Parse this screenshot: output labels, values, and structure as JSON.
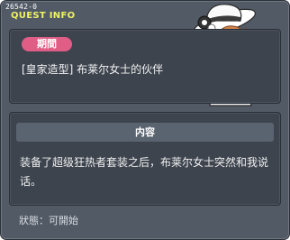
{
  "window": {
    "quest_id": "26542-0",
    "title": "QUEST INFO"
  },
  "period": {
    "badge_label": "期間",
    "badge_color": "#e05d86"
  },
  "quest": {
    "name": "[皇家造型] 布莱尔女士的伙伴"
  },
  "content": {
    "header": "内容",
    "text": "装备了超级狂热者套装之后，布莱尔女士突然和我说话。"
  },
  "status": {
    "text": "狀態：可開始"
  },
  "portrait": {
    "icon": "npc-lady-portrait"
  },
  "colors": {
    "title_yellow": "#eef265",
    "panel_bg": "#3d444e",
    "window_bg": "#525a66"
  }
}
